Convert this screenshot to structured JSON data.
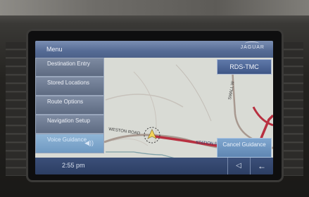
{
  "header": {
    "title": "Menu",
    "brand": "JAGUAR"
  },
  "menu": {
    "items": [
      {
        "label": "Destination Entry"
      },
      {
        "label": "Stored Locations"
      },
      {
        "label": "Route Options"
      },
      {
        "label": "Navigation Setup"
      },
      {
        "label": "Voice Guidance",
        "icon": "speaker-icon"
      }
    ]
  },
  "map": {
    "roads": [
      "WESTON ROAD",
      "STATION ROAD",
      "SMALL W"
    ]
  },
  "buttons": {
    "rds_tmc": "RDS-TMC",
    "cancel_guidance": "Cancel Guidance",
    "back": "←",
    "volume": "◁"
  },
  "status": {
    "time": "2:55 pm"
  },
  "colors": {
    "menu_bg": "#5e6b82",
    "active_item": "#6f99c2",
    "route": "#b83040",
    "road": "#a89990",
    "topbar": "#556b95"
  }
}
